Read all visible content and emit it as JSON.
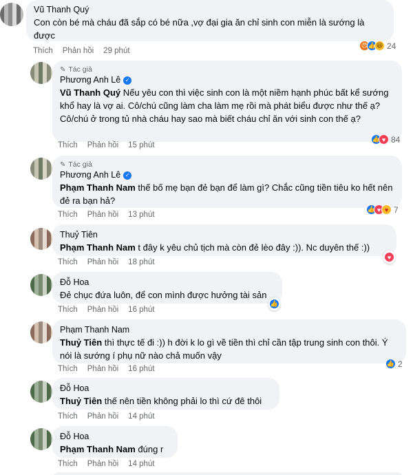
{
  "comments": [
    {
      "name": "Vũ Thanh Quý",
      "text": "Con còn bé mà cháu đã sắp có bé nữa ,vợ đại gia ăn chỉ sinh con miễn là sướng là được",
      "like": "Thích",
      "reply": "Phản hồi",
      "time": "29 phút",
      "reaction_count": "24",
      "reactions": [
        "angry-icon",
        "like-icon",
        "haha-icon"
      ]
    },
    {
      "badge": "Tác giả",
      "name": "Phương Anh Lê",
      "mention": "Vũ Thanh Quý",
      "text": " Nếu yêu con thì việc sinh con là một niềm hạnh phúc bất kể sướng khổ hay là vợ ai. Cô/chú cũng làm cha làm mẹ rồi mà phát biểu được như thế ạ? Cô/chú ở trong tủ nhà cháu hay sao mà biết cháu chỉ ăn với sinh con thế ạ?",
      "like": "Thích",
      "reply": "Phản hồi",
      "time": "15 phút",
      "reaction_count": "84",
      "reactions": [
        "like-icon",
        "love-icon"
      ]
    },
    {
      "badge": "Tác giả",
      "name": "Phương Anh Lê",
      "mention": "Phạm Thanh Nam",
      "text": " thế bố mẹ bạn đẻ bạn để làm gì? Chắc cũng tiền tiêu ko hết nên đẻ ra bạn hả?",
      "like": "Thích",
      "reply": "Phản hồi",
      "time": "13 phút",
      "reaction_count": "7",
      "reactions": [
        "like-icon",
        "love-icon",
        "care-icon"
      ]
    },
    {
      "name": "Thuỷ Tiên",
      "mention": "Phạm Thanh Nam",
      "text": " t đây k yêu chủ tịch mà còn đẻ lèo đây :)). Nc duyên thế :))",
      "like": "Thích",
      "reply": "Phản hồi",
      "time": "18 phút",
      "reactions": [
        "love-icon"
      ]
    },
    {
      "name": "Đỗ Hoa",
      "text": "Đẻ chục đứa luôn, để con mình được hưởng tài sản",
      "like": "Thích",
      "reply": "Phản hồi",
      "time": "16 phút",
      "reactions": [
        "like-icon"
      ]
    },
    {
      "name": "Phạm Thanh Nam",
      "mention": "Thuỷ Tiên",
      "text": " thì thực tế đi :)) h đời k lo gì về tiền thì chỉ cần tập trung sinh con thôi. Ý nói là sướng í phụ nữ nào chả muốn vậy",
      "like": "Thích",
      "reply": "Phản hồi",
      "time": "16 phút",
      "reaction_count": "2",
      "reactions": [
        "like-icon"
      ]
    },
    {
      "name": "Đỗ Hoa",
      "mention": "Thuỷ Tiên",
      "text": " thế nên tiền không phải lo thì cứ đê thôi",
      "like": "Thích",
      "reply": "Phản hồi",
      "time": "14 phút"
    },
    {
      "name": "Đỗ Hoa",
      "mention": "Phạm Thanh Nam",
      "text": " đúng r",
      "like": "Thích",
      "reply": "Phản hồi",
      "time": "14 phút"
    }
  ]
}
